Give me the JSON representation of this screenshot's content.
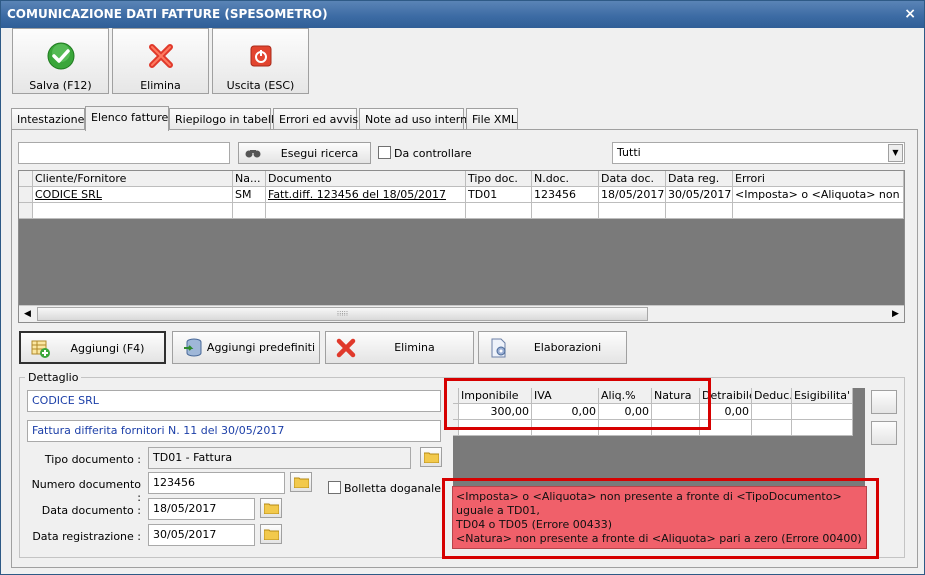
{
  "window": {
    "title": "COMUNICAZIONE DATI FATTURE (SPESOMETRO)",
    "close_glyph": "×"
  },
  "toolbar": {
    "save_label": "Salva (F12)",
    "delete_label": "Elimina",
    "exit_label": "Uscita (ESC)"
  },
  "tabs": [
    "Intestazione",
    "Elenco fatture",
    "Riepilogo in tabella",
    "Errori ed avvisi",
    "Note ad uso interno",
    "File XML"
  ],
  "active_tab": "Elenco fatture",
  "search": {
    "value": "",
    "button_label": "Esegui ricerca",
    "checkbox_label": "Da controllare",
    "checkbox_checked": false,
    "filter_value": "Tutti"
  },
  "invoice_table": {
    "columns": [
      "Cliente/Fornitore",
      "Na...",
      "Documento",
      "Tipo doc.",
      "N.doc.",
      "Data doc.",
      "Data reg.",
      "Errori"
    ],
    "rows": [
      [
        "CODICE SRL",
        "SM",
        "Fatt.diff. 123456 del 18/05/2017",
        "TD01",
        "123456",
        "18/05/2017",
        "30/05/2017",
        "<Imposta> o <Aliquota> non prese"
      ]
    ]
  },
  "actions": {
    "add_label": "Aggiungi (F4)",
    "add_predefined_label": "Aggiungi predefiniti",
    "delete_label": "Elimina",
    "processing_label": "Elaborazioni"
  },
  "detail": {
    "legend": "Dettaglio",
    "party": "CODICE SRL",
    "description": "Fattura differita fornitori N. 11 del 30/05/2017",
    "doc_type_label": "Tipo documento :",
    "doc_type_value": "TD01 - Fattura",
    "doc_number_label": "Numero documento :",
    "doc_number_value": "123456",
    "customs_label": "Bolletta doganale",
    "customs_checked": false,
    "doc_date_label": "Data documento :",
    "doc_date_value": "18/05/2017",
    "reg_date_label": "Data registrazione :",
    "reg_date_value": "30/05/2017"
  },
  "vat_table": {
    "columns": [
      "Imponibile",
      "IVA",
      "Aliq.%",
      "Natura",
      "Detraibile",
      "Deduc.",
      "Esigibilita'"
    ],
    "rows": [
      [
        "300,00",
        "0,00",
        "0,00",
        "",
        "0,00",
        "",
        ""
      ]
    ]
  },
  "errors": {
    "line1": "<Imposta> o <Aliquota> non presente a fronte di <TipoDocumento> uguale a TD01,",
    "line2": "TD04 o TD05 (Errore 00433)",
    "line3": "<Natura> non presente a fronte di <Aliquota> pari a zero (Errore 00400)"
  },
  "colors": {
    "title_bar": "#3b6aa3",
    "error_background": "#f0606a",
    "highlight_border": "#d60000",
    "link_text": "#1c3fa8"
  }
}
